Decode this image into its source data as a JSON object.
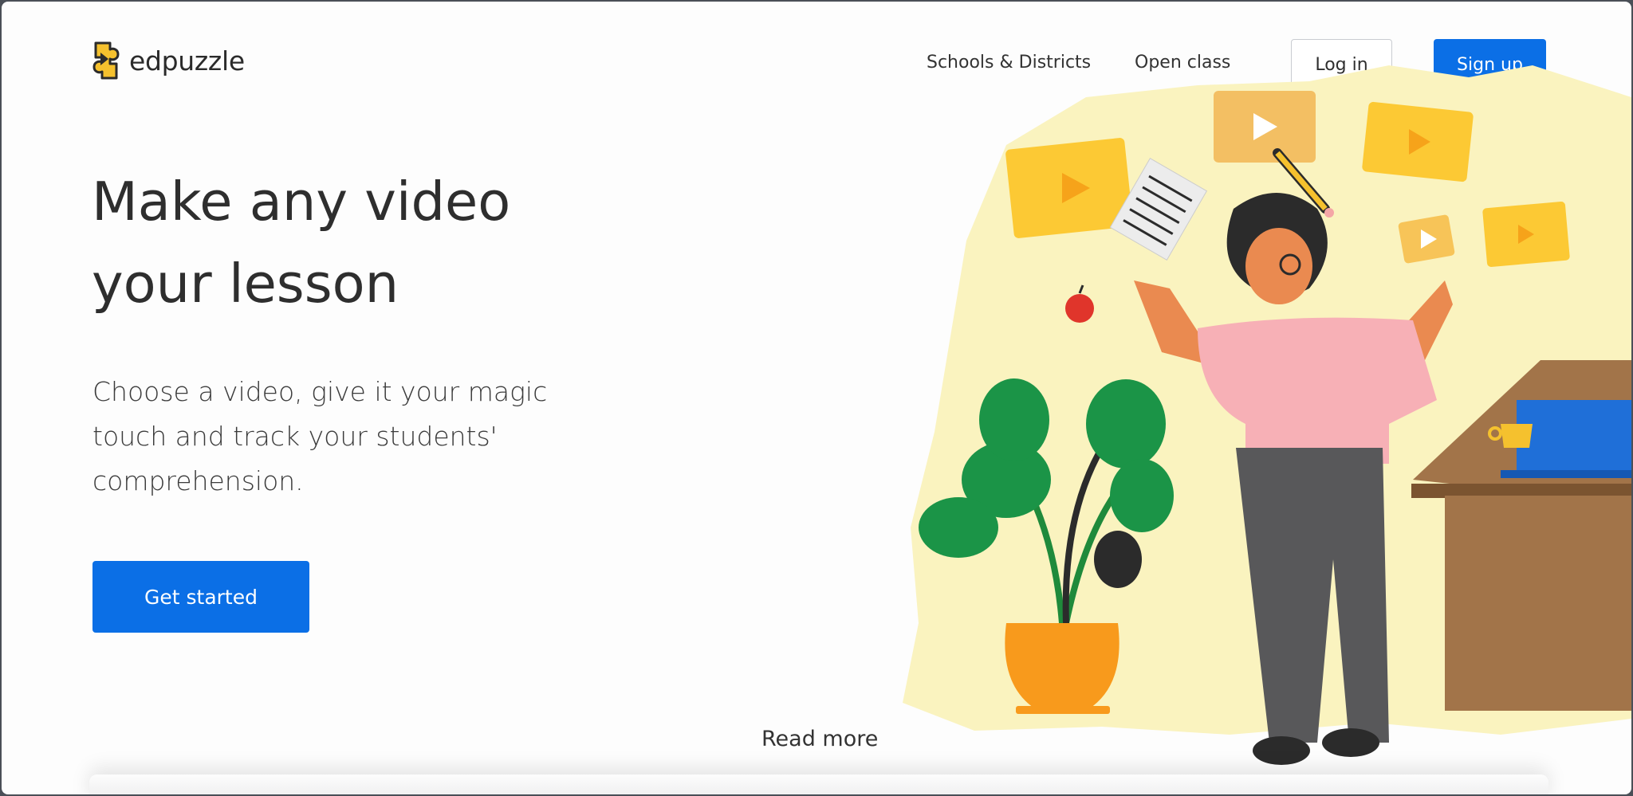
{
  "brand": {
    "name": "edpuzzle",
    "logo_icon": "puzzle-piece-icon",
    "logo_color": "#f5c12e"
  },
  "nav": {
    "schools": "Schools & Districts",
    "open_class": "Open class",
    "login": "Log in",
    "signup": "Sign up"
  },
  "hero": {
    "title_line1": "Make any video",
    "title_line2": "your lesson",
    "subtitle": "Choose a video, give it your magic touch and track your students' comprehension.",
    "cta": "Get started"
  },
  "read_more": "Read more",
  "colors": {
    "accent": "#0b6fe6",
    "illustration_bg": "#faf3bf",
    "video_yellow": "#fcc934"
  }
}
